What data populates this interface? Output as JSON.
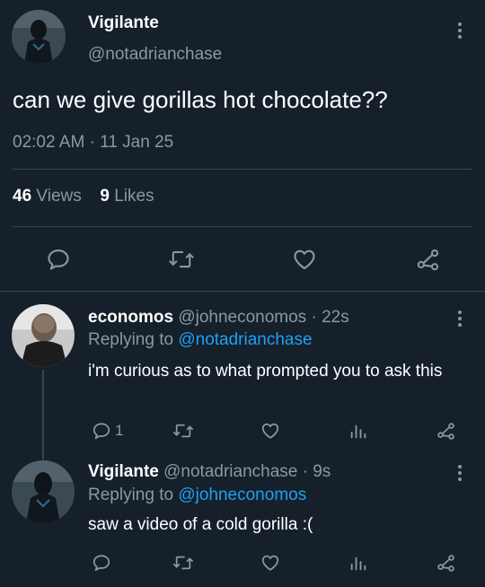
{
  "main_tweet": {
    "display_name": "Vigilante",
    "handle": "@notadrianchase",
    "text": "can we give gorillas hot chocolate??",
    "time": "02:02 AM",
    "sep": "·",
    "date": "11 Jan 25",
    "views_count": "46",
    "views_label": "Views",
    "likes_count": "9",
    "likes_label": "Likes"
  },
  "reply1": {
    "display_name": "economos",
    "handle": "@johneconomos",
    "sep": "·",
    "age": "22s",
    "replying_prefix": "Replying to",
    "replying_to": "@notadrianchase",
    "text": "i'm curious as to what prompted you to ask this",
    "reply_count": "1"
  },
  "reply2": {
    "display_name": "Vigilante",
    "handle": "@notadrianchase",
    "sep": "·",
    "age": "9s",
    "replying_prefix": "Replying to",
    "replying_to": "@johneconomos",
    "text": "saw a video of a cold gorilla :("
  },
  "colors": {
    "background": "#15202b",
    "text": "#ffffff",
    "muted": "#8899a6",
    "accent": "#1da1f2",
    "divider": "#38444d"
  },
  "icons": [
    "more-icon",
    "reply-icon",
    "retweet-icon",
    "like-icon",
    "share-icon",
    "views-icon"
  ]
}
